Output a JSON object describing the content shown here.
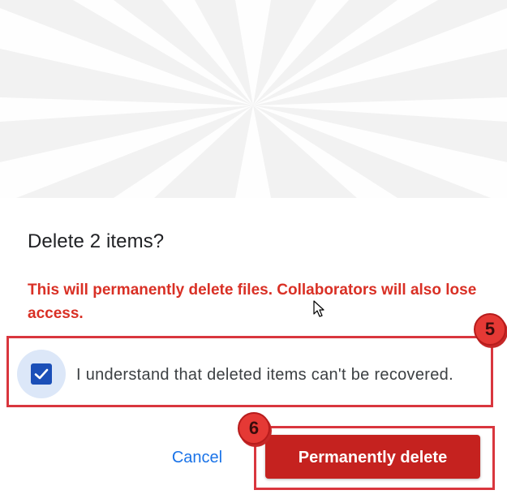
{
  "dialog": {
    "title": "Delete 2 items?",
    "warning": "This will permanently delete files. Collaborators will also lose access.",
    "acknowledge_label": "I understand that deleted items can't be recovered.",
    "acknowledge_checked": true,
    "cancel_label": "Cancel",
    "delete_label": "Permanently delete"
  },
  "annotations": {
    "step_5": "5",
    "step_6": "6"
  },
  "icons": {
    "hero": "sunburst-illustration",
    "checkbox": "checkmark-icon",
    "cursor": "mouse-pointer-icon"
  },
  "colors": {
    "warning": "#d93025",
    "primary_action": "#c5221f",
    "link": "#1a73e8",
    "checkbox": "#1b4fb8",
    "annotation": "#d9363e"
  }
}
